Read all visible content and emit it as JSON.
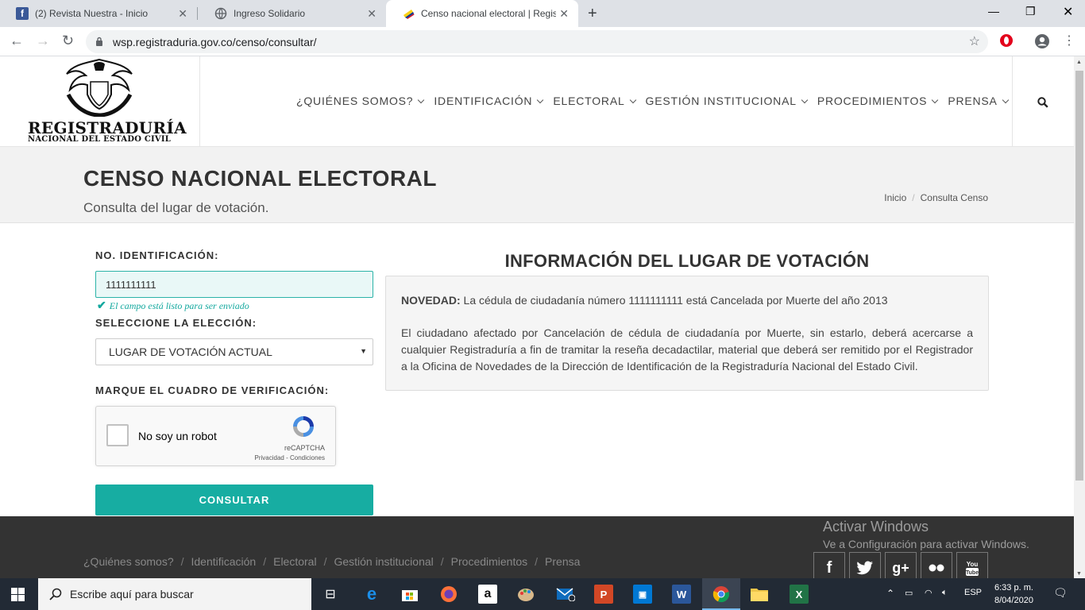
{
  "browser": {
    "tabs": [
      {
        "title": "(2) Revista Nuestra - Inicio"
      },
      {
        "title": "Ingreso Solidario"
      },
      {
        "title": "Censo nacional electoral | Regist"
      }
    ],
    "url": "wsp.registraduria.gov.co/censo/consultar/"
  },
  "logo": {
    "title": "REGISTRADURÍA",
    "subtitle": "NACIONAL DEL ESTADO CIVIL"
  },
  "nav": {
    "items": [
      "¿QUIÉNES SOMOS?",
      "IDENTIFICACIÓN",
      "ELECTORAL",
      "GESTIÓN INSTITUCIONAL",
      "PROCEDIMIENTOS",
      "PRENSA"
    ]
  },
  "page": {
    "title": "CENSO NACIONAL ELECTORAL",
    "subtitle": "Consulta del lugar de votación.",
    "breadcrumb": [
      "Inicio",
      "Consulta Censo"
    ]
  },
  "form": {
    "id_label": "NO. IDENTIFICACIÓN:",
    "id_value": "1111111111",
    "valid_msg": "El campo está listo para ser enviado",
    "election_label": "SELECCIONE LA ELECCIÓN:",
    "election_value": "LUGAR DE VOTACIÓN ACTUAL",
    "verify_label": "MARQUE EL CUADRO DE VERIFICACIÓN:",
    "captcha_label": "No soy un robot",
    "captcha_brand": "reCAPTCHA",
    "captcha_links": "Privacidad - Condiciones",
    "submit": "CONSULTAR"
  },
  "info": {
    "title": "INFORMACIÓN DEL LUGAR DE VOTACIÓN",
    "novedad_label": "NOVEDAD:",
    "novedad_text": " La cédula de ciudadanía número 1111111111 está Cancelada por Muerte del año 2013",
    "paragraph": "El ciudadano afectado por Cancelación de cédula de ciudadanía por Muerte, sin estarlo, deberá acercarse a cualquier Registraduría a fin de tramitar la reseña decadactilar, material que deberá ser remitido por el Registrador a la Oficina de Novedades de la Dirección de Identificación de la Registraduría Nacional del Estado Civil."
  },
  "footer": {
    "links": [
      "¿Quiénes somos?",
      "Identificación",
      "Electoral",
      "Gestión institucional",
      "Procedimientos",
      "Prensa"
    ],
    "activate_title": "Activar Windows",
    "activate_sub": "Ve a Configuración para activar Windows."
  },
  "taskbar": {
    "search_placeholder": "Escribe aquí para buscar",
    "lang": "ESP",
    "time": "6:33 p. m.",
    "date": "8/04/2020"
  }
}
